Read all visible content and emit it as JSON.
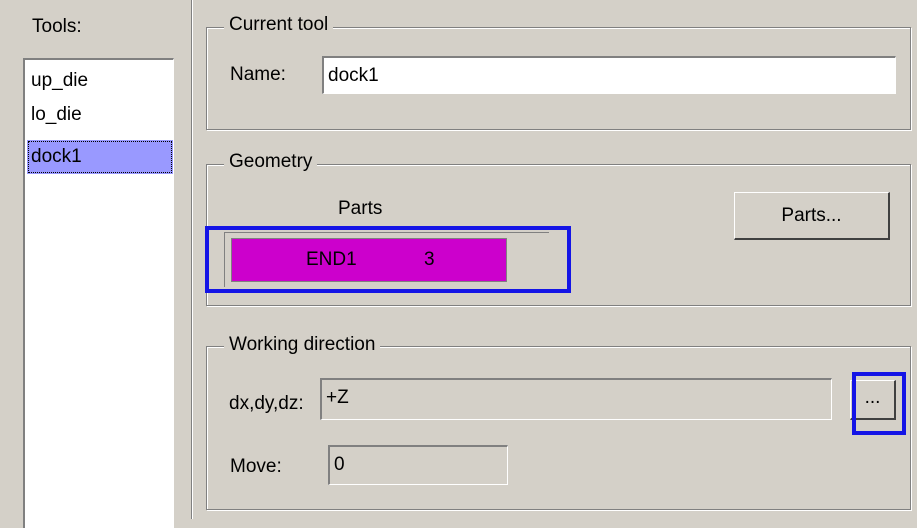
{
  "tools_panel": {
    "label": "Tools:",
    "items": [
      {
        "label": "up_die",
        "selected": false
      },
      {
        "label": "lo_die",
        "selected": false
      },
      {
        "label": "dock1",
        "selected": true
      }
    ]
  },
  "current_tool": {
    "title": "Current tool",
    "name_label": "Name:",
    "name_value": "dock1"
  },
  "geometry": {
    "title": "Geometry",
    "parts_header": "Parts",
    "parts_button_label": "Parts...",
    "parts": [
      {
        "name": "END1",
        "id": "3",
        "color": "#cc00cc"
      }
    ]
  },
  "working_direction": {
    "title": "Working direction",
    "direction_label": "dx,dy,dz:",
    "direction_value": "+Z",
    "browse_button_label": "...",
    "move_label": "Move:",
    "move_value": "0"
  },
  "colors": {
    "background": "#d4d0c8",
    "selection": "#9999ff",
    "part_highlight": "#cc00cc",
    "annotation_box": "#1414e6"
  }
}
